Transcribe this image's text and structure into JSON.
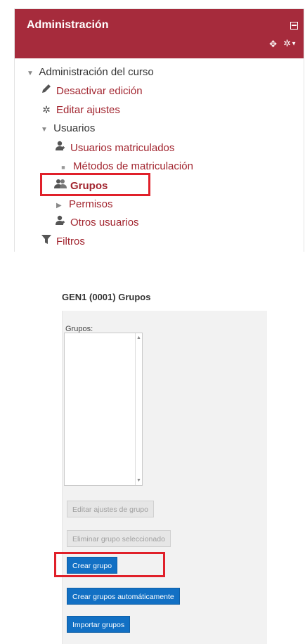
{
  "admin": {
    "title": "Administración",
    "tree": [
      {
        "label": "Administración del curso",
        "icon": "triangle-down-icon",
        "style": "plain"
      },
      {
        "label": "Desactivar edición",
        "icon": "pencil-icon",
        "style": "link"
      },
      {
        "label": "Editar ajustes",
        "icon": "gear-icon",
        "style": "link"
      },
      {
        "label": "Usuarios",
        "icon": "triangle-down-icon",
        "style": "plain"
      },
      {
        "label": "Usuarios matriculados",
        "icon": "enrolled-users-icon",
        "style": "link"
      },
      {
        "label": "Métodos de matriculación",
        "icon": "square-bullet-icon",
        "style": "link"
      },
      {
        "label": "Grupos",
        "icon": "group-icon",
        "style": "link-bold"
      },
      {
        "label": "Permisos",
        "icon": "triangle-right-icon",
        "style": "link"
      },
      {
        "label": "Otros usuarios",
        "icon": "other-users-icon",
        "style": "link"
      },
      {
        "label": "Filtros",
        "icon": "filter-icon",
        "style": "link"
      }
    ]
  },
  "groups": {
    "title": "GEN1 (0001) Grupos",
    "list_label": "Grupos:",
    "buttons": {
      "edit": "Editar ajustes de grupo",
      "delete": "Eliminar grupo seleccionado",
      "create": "Crear grupo",
      "auto_create": "Crear grupos automáticamente",
      "import": "Importar grupos"
    }
  },
  "colors": {
    "header": "#a62b3c",
    "link": "#a2252f",
    "highlight": "#e0202a",
    "primary_button": "#1270c4"
  }
}
